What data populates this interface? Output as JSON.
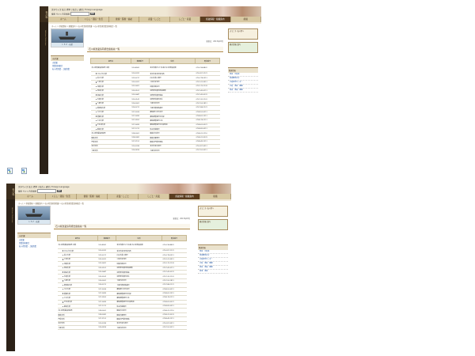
{
  "site": {
    "logo": "石川県",
    "side_text": "Ishikawa Prefecture"
  },
  "header": {
    "util_line1": "文字サイズ 拡大 標準 | 色合い 通常 | Foreign Language",
    "util_line2": "検索 サイト内を検索 ",
    "search_button": "検索",
    "nav": [
      {
        "label": "ホーム"
      },
      {
        "label": "くらし・環境・生活"
      },
      {
        "label": "健康・医療・福祉"
      },
      {
        "label": "産業・しごと"
      },
      {
        "label": "しごと・産業"
      },
      {
        "label": "県政情報・組織案内",
        "active": true
      },
      {
        "label": "組織"
      }
    ]
  },
  "breadcrumb": "ホーム > 県政情報 > 組織案内 > 石川県漁港漁場課 > 石川県漁港漁業協同組合一覧",
  "left_sidebar": {
    "banner_caption": "ＬＩＺ・水産",
    "section_title": "水産課",
    "links": [
      "水産課",
      "漁業協同組合",
      "石川県漁業・上級漁業"
    ]
  },
  "main": {
    "date": "更新日：2013年03月",
    "title": "石川県漁業協同組合連絡先一覧",
    "columns": [
      "組合名",
      "郵便番号",
      "住所",
      "電話番号"
    ],
    "rows": [
      {
        "name": "石川県漁業協同組合 本所",
        "zip": "920-8581",
        "addr": "金沢市鞍月1丁目1番 石川県漁協会館",
        "tel": "076-234-8822",
        "big": true
      },
      {
        "name": "かなざわ支所",
        "zip": "920-0331",
        "addr": "金沢市金石町金石西",
        "tel": "076-267-1121",
        "sub": true
      },
      {
        "name": "美川支所",
        "zip": "929-0217",
        "addr": "白山市美川南町",
        "tel": "076-278-2311",
        "sub": true
      },
      {
        "name": "小松支所",
        "zip": "923-0321",
        "addr": "小松市安宅町",
        "tel": "0761-22-3511",
        "sub": true
      },
      {
        "name": "加賀支所",
        "zip": "922-0421",
        "addr": "加賀市橋立町",
        "tel": "0761-75-1133",
        "sub": true
      },
      {
        "name": "西海支所",
        "zip": "925-0161",
        "addr": "羽咋郡志賀町西海風無",
        "tel": "0767-42-0111",
        "sub": true
      },
      {
        "name": "富来支所",
        "zip": "925-0447",
        "addr": "羽咋郡志賀町富来",
        "tel": "0767-42-0231",
        "sub": true
      },
      {
        "name": "志賀支所",
        "zip": "925-0141",
        "addr": "羽咋郡志賀町赤住",
        "tel": "0767-32-1101",
        "sub": true
      },
      {
        "name": "七尾支所",
        "zip": "926-0001",
        "addr": "七尾市府中町",
        "tel": "0767-53-1811",
        "sub": true
      },
      {
        "name": "能登島支所",
        "zip": "926-0211",
        "addr": "七尾市能登島曲町",
        "tel": "0767-84-1121",
        "sub": true
      },
      {
        "name": "穴水支所",
        "zip": "927-0026",
        "addr": "鳳珠郡穴水町大町",
        "tel": "0768-52-0211",
        "sub": true
      },
      {
        "name": "能都支所",
        "zip": "927-0435",
        "addr": "鳳珠郡能登町宇出津",
        "tel": "0768-62-1311",
        "sub": true
      },
      {
        "name": "小木支所",
        "zip": "927-0552",
        "addr": "鳳珠郡能登町小木",
        "tel": "0768-74-1111",
        "sub": true
      },
      {
        "name": "宇出津支所",
        "zip": "927-0433",
        "addr": "鳳珠郡能登町宇出津新港",
        "tel": "0768-62-0321",
        "sub": true
      },
      {
        "name": "蛸島支所",
        "zip": "927-1211",
        "addr": "珠洲市蛸島町",
        "tel": "0768-82-0311",
        "sub": true
      },
      {
        "name": "石川県漁業協同組合",
        "zip": "928-0001",
        "addr": "輪島市河井町",
        "tel": "0768-22-1110"
      },
      {
        "name": "輪島支所",
        "zip": "928-0081",
        "addr": "輪島市鳳至町",
        "tel": "0768-22-3223"
      },
      {
        "name": "門前支所",
        "zip": "927-2151",
        "addr": "輪島市門前町黒島",
        "tel": "0768-43-1211"
      },
      {
        "name": "金沢支所",
        "zip": "920-0336",
        "addr": "金沢市金石本町",
        "tel": "076-267-0511"
      },
      {
        "name": "七尾支所",
        "zip": "926-0816",
        "addr": "七尾市府中町",
        "tel": "0767-52-3211"
      }
    ]
  },
  "right_sidebar": {
    "banner1": "ようこそ 石川県へ",
    "banner2": "観光情報 案内",
    "section_title": "関連情報",
    "links": [
      "漁業・水産業",
      "漁業関係法令",
      "水産総合センター",
      "水産・漁業・関連",
      "漁業・漁協・関連",
      "漁港・漁場"
    ]
  }
}
